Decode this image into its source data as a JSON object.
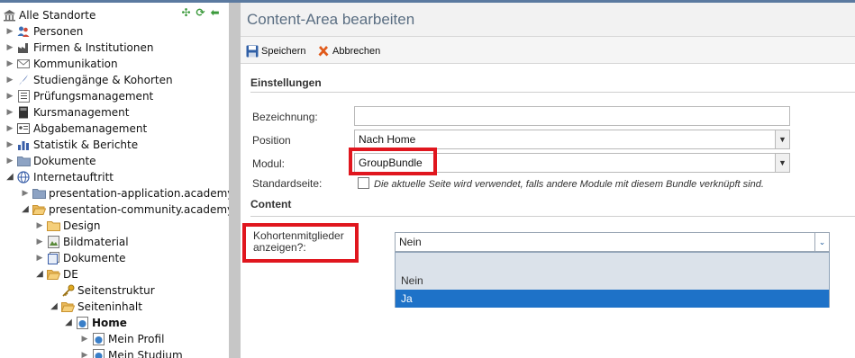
{
  "tree": {
    "root_label": "Alle Standorte",
    "items": [
      {
        "label": "Personen"
      },
      {
        "label": "Firmen & Institutionen"
      },
      {
        "label": "Kommunikation"
      },
      {
        "label": "Studiengänge & Kohorten"
      },
      {
        "label": "Prüfungsmanagement"
      },
      {
        "label": "Kursmanagement"
      },
      {
        "label": "Abgabemanagement"
      },
      {
        "label": "Statistik & Berichte"
      },
      {
        "label": "Dokumente"
      },
      {
        "label": "Internetauftritt"
      },
      {
        "label": "presentation-application.academyfive"
      },
      {
        "label": "presentation-community.academyfive"
      },
      {
        "label": "Design"
      },
      {
        "label": "Bildmaterial"
      },
      {
        "label": "Dokumente"
      },
      {
        "label": "DE"
      },
      {
        "label": "Seitenstruktur"
      },
      {
        "label": "Seiteninhalt"
      },
      {
        "label": "Home"
      },
      {
        "label": "Mein Profil"
      },
      {
        "label": "Mein Studium"
      }
    ]
  },
  "panel": {
    "title": "Content-Area bearbeiten",
    "toolbar": {
      "save_label": "Speichern",
      "cancel_label": "Abbrechen"
    },
    "section_settings": "Einstellungen",
    "fields": {
      "bezeichnung_label": "Bezeichnung:",
      "bezeichnung_value": "",
      "position_label": "Position",
      "position_value": "Nach Home",
      "modul_label": "Modul:",
      "modul_value": "GroupBundle",
      "standardseite_label": "Standardseite:",
      "standardseite_hint": "Die aktuelle Seite wird verwendet, falls andere Module mit diesem Bundle verknüpft sind."
    },
    "section_content": "Content",
    "kohorten": {
      "label_line1": "Kohortenmitglieder",
      "label_line2": "anzeigen?:",
      "value": "Nein",
      "options": [
        "Nein",
        "Ja"
      ],
      "highlighted_option": "Ja"
    }
  },
  "colors": {
    "highlight_red": "#e0161e",
    "option_selected_bg": "#1e72c8",
    "title_text": "#5a6e82"
  }
}
